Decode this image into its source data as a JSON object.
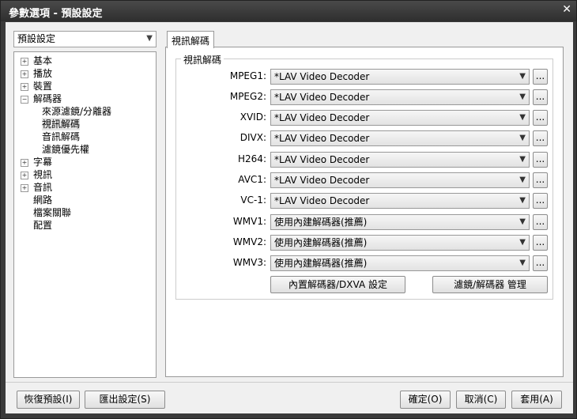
{
  "window": {
    "title": "參數選項 - 預設設定",
    "close": "✕"
  },
  "profile_select": "預設設定",
  "tree": [
    {
      "label": "基本",
      "expander": "+"
    },
    {
      "label": "播放",
      "expander": "+"
    },
    {
      "label": "裝置",
      "expander": "+"
    },
    {
      "label": "解碼器",
      "expander": "−"
    },
    {
      "label": "來源濾鏡/分離器",
      "child": true
    },
    {
      "label": "視訊解碼",
      "child": true,
      "selected": true
    },
    {
      "label": "音訊解碼",
      "child": true
    },
    {
      "label": "濾鏡優先權",
      "child": true
    },
    {
      "label": "字幕",
      "expander": "+"
    },
    {
      "label": "視訊",
      "expander": "+"
    },
    {
      "label": "音訊",
      "expander": "+"
    },
    {
      "label": "網路"
    },
    {
      "label": "檔案關聯"
    },
    {
      "label": "配置"
    }
  ],
  "tab": "視訊解碼",
  "group_title": "視訊解碼",
  "decoders": [
    {
      "label": "MPEG1:",
      "value": "*LAV Video Decoder"
    },
    {
      "label": "MPEG2:",
      "value": "*LAV Video Decoder"
    },
    {
      "label": "XVID:",
      "value": "*LAV Video Decoder"
    },
    {
      "label": "DIVX:",
      "value": "*LAV Video Decoder"
    },
    {
      "label": "H264:",
      "value": "*LAV Video Decoder"
    },
    {
      "label": "AVC1:",
      "value": "*LAV Video Decoder"
    },
    {
      "label": "VC-1:",
      "value": "*LAV Video Decoder"
    },
    {
      "label": "WMV1:",
      "value": "使用內建解碼器(推薦)"
    },
    {
      "label": "WMV2:",
      "value": "使用內建解碼器(推薦)"
    },
    {
      "label": "WMV3:",
      "value": "使用內建解碼器(推薦)"
    }
  ],
  "more_label": "...",
  "dxva_button": "內置解碼器/DXVA 設定",
  "manage_button": "濾鏡/解碼器 管理",
  "footer": {
    "restore": "恢復預設(I)",
    "export": "匯出設定(S)",
    "ok": "確定(O)",
    "cancel": "取消(C)",
    "apply": "套用(A)"
  }
}
